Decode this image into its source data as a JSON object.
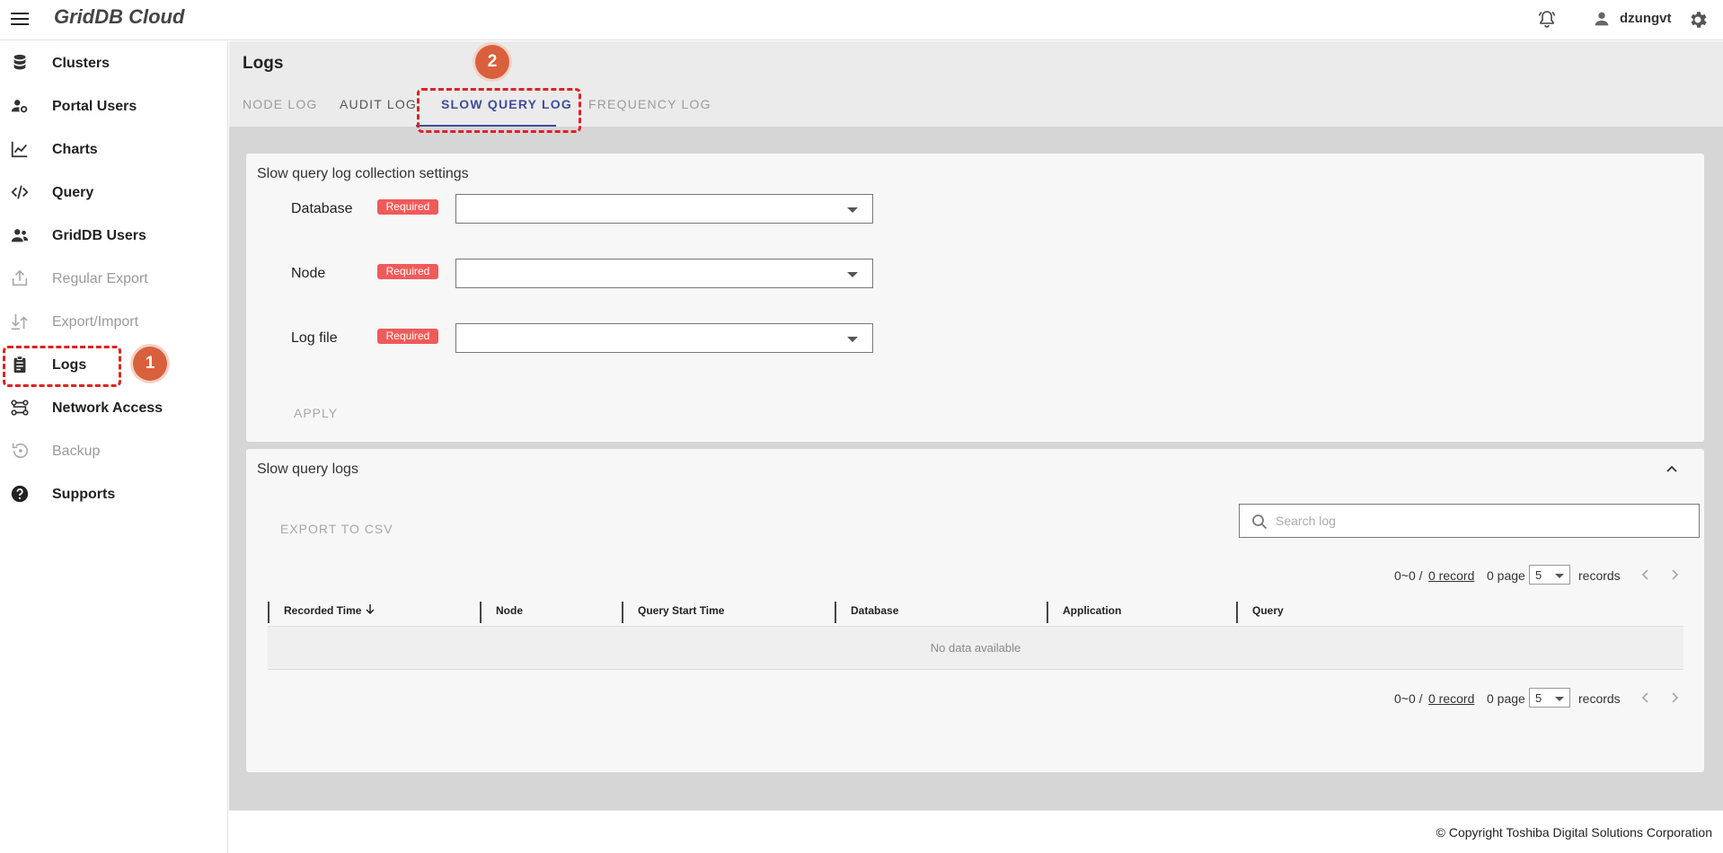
{
  "app": {
    "title": "GridDB Cloud",
    "username": "dzungvt"
  },
  "sidebar": {
    "items": [
      {
        "label": "Clusters",
        "icon": "database-icon",
        "disabled": false
      },
      {
        "label": "Portal Users",
        "icon": "user-gear-icon",
        "disabled": false
      },
      {
        "label": "Charts",
        "icon": "line-chart-icon",
        "disabled": false
      },
      {
        "label": "Query",
        "icon": "code-icon",
        "disabled": false
      },
      {
        "label": "GridDB Users",
        "icon": "users-icon",
        "disabled": false
      },
      {
        "label": "Regular Export",
        "icon": "export-icon",
        "disabled": true
      },
      {
        "label": "Export/Import",
        "icon": "import-export-icon",
        "disabled": true
      },
      {
        "label": "Logs",
        "icon": "clipboard-icon",
        "disabled": false
      },
      {
        "label": "Network Access",
        "icon": "network-icon",
        "disabled": false
      },
      {
        "label": "Backup",
        "icon": "backup-icon",
        "disabled": true
      },
      {
        "label": "Supports",
        "icon": "help-icon",
        "disabled": false
      }
    ]
  },
  "markers": {
    "one": "1",
    "two": "2"
  },
  "main": {
    "title": "Logs",
    "tabs": [
      "NODE LOG",
      "AUDIT LOG",
      "SLOW QUERY LOG",
      "FREQUENCY LOG"
    ],
    "active_tab": "SLOW QUERY LOG"
  },
  "settings": {
    "title": "Slow query log collection settings",
    "required_label": "Required",
    "fields": [
      {
        "label": "Database",
        "value": ""
      },
      {
        "label": "Node",
        "value": ""
      },
      {
        "label": "Log file",
        "value": ""
      }
    ],
    "apply_label": "APPLY"
  },
  "logs": {
    "title": "Slow query logs",
    "export_label": "EXPORT TO CSV",
    "search_placeholder": "Search log",
    "pager": {
      "range": "0~0 /",
      "records_link": "0 record",
      "page": "0 page",
      "per_page": "5",
      "records_label": "records"
    },
    "columns": [
      "Recorded Time",
      "Node",
      "Query Start Time",
      "Database",
      "Application",
      "Query"
    ],
    "empty_text": "No data available"
  },
  "footer": {
    "copyright": "© Copyright Toshiba Digital Solutions Corporation"
  }
}
